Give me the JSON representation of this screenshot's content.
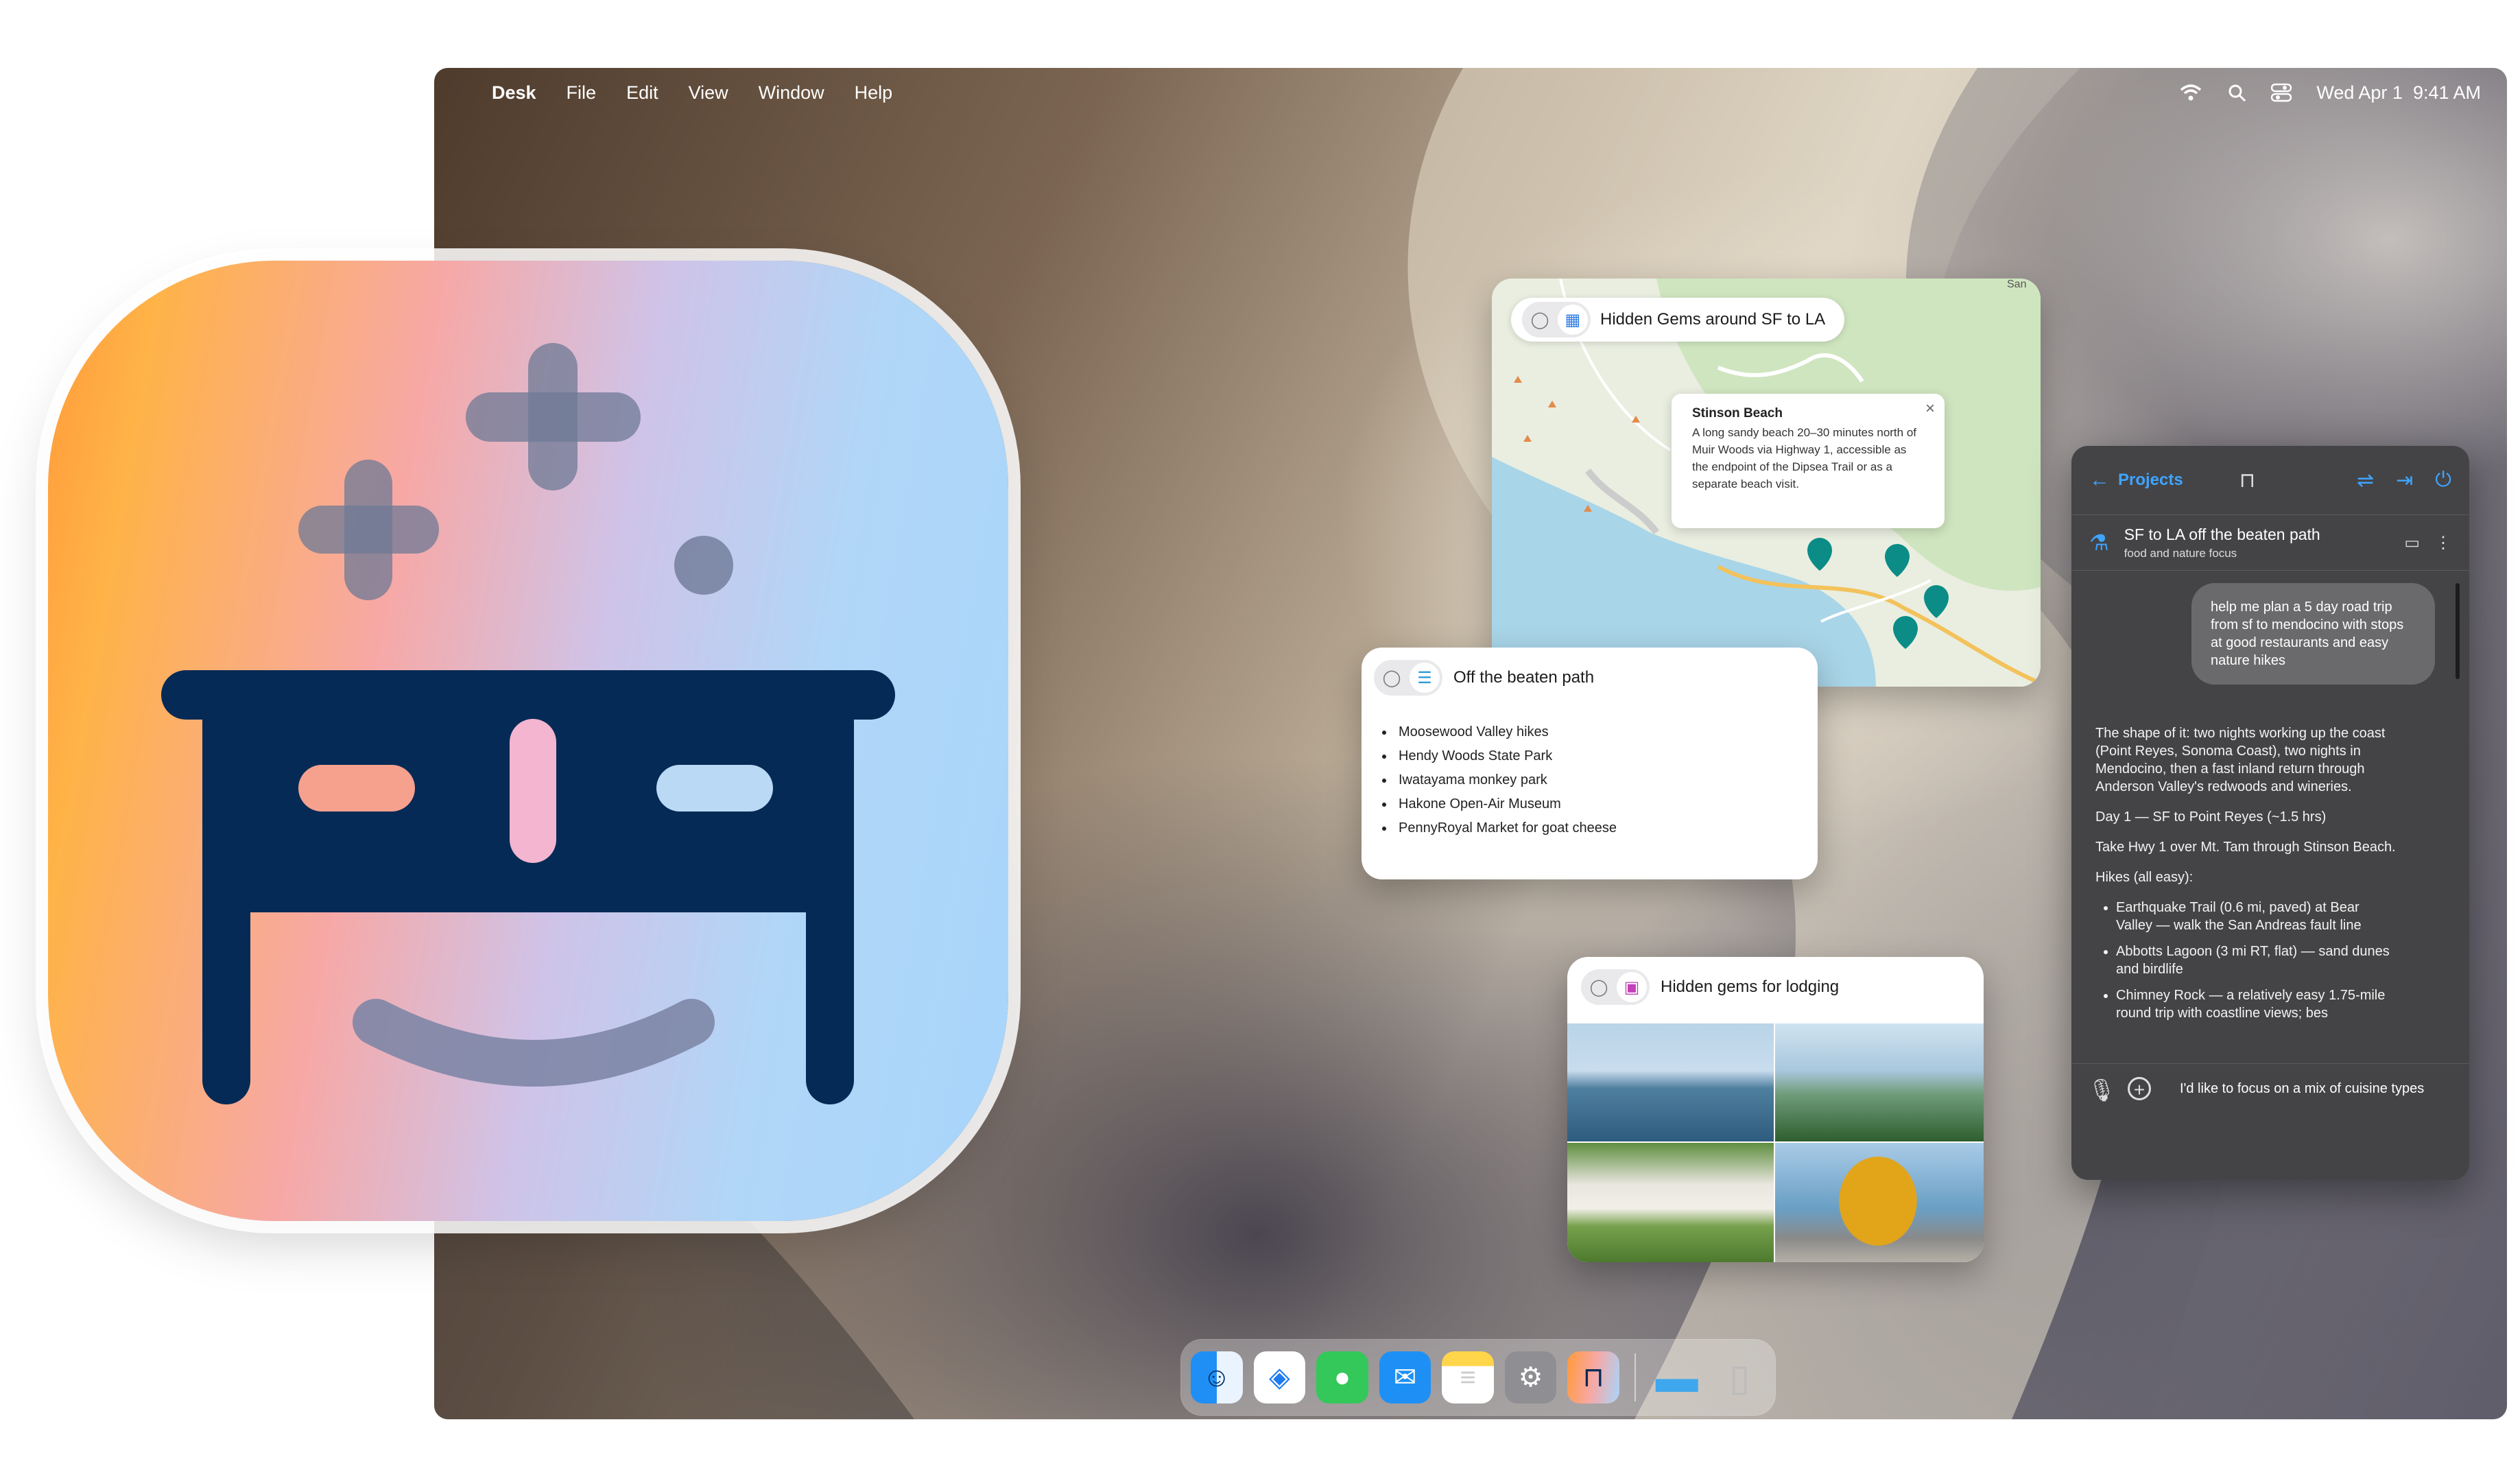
{
  "menubar": {
    "app_name": "Desk",
    "items": [
      "File",
      "Edit",
      "View",
      "Window",
      "Help"
    ],
    "date": "Wed Apr 1",
    "time": "9:41 AM"
  },
  "map_card": {
    "title": "Hidden Gems around SF to LA",
    "popup_title": "Stinson Beach",
    "popup_body": "A long sandy beach 20–30 minutes north of Muir Woods via Highway 1, accessible as the endpoint of the Dipsea Trail or as a separate beach visit.",
    "corner_label": "San"
  },
  "list_card": {
    "title": "Off the beaten path",
    "items": [
      "Moosewood Valley hikes",
      "Hendy Woods State Park",
      "Iwatayama monkey park",
      "Hakone Open-Air Museum",
      "PennyRoyal Market for goat cheese"
    ]
  },
  "photo_card": {
    "title": "Hidden gems for lodging"
  },
  "chat": {
    "back_label": "Projects",
    "project_title": "SF to LA off the beaten path",
    "project_subtitle": "food and nature focus",
    "user_message": "help me plan a 5 day road trip from sf to mendocino with stops at good restaurants and easy nature hikes",
    "reply_intro": "The shape of it: two nights working up the coast (Point Reyes, Sonoma Coast), two nights in Mendocino, then a fast inland return through Anderson Valley's redwoods and wineries.",
    "reply_day": "Day 1 — SF to Point Reyes (~1.5 hrs)",
    "reply_route": "Take Hwy 1 over Mt. Tam through Stinson Beach.",
    "reply_hikes_label": "Hikes (all easy):",
    "reply_hikes": [
      "Earthquake Trail (0.6 mi, paved) at Bear Valley — walk the San Andreas fault line",
      "Abbotts Lagoon (3 mi RT, flat) — sand dunes and birdlife",
      "Chimney Rock — a relatively easy 1.75-mile round trip with coastline views; bes"
    ],
    "input_text": "I'd like to focus on a mix of  cuisine types"
  }
}
